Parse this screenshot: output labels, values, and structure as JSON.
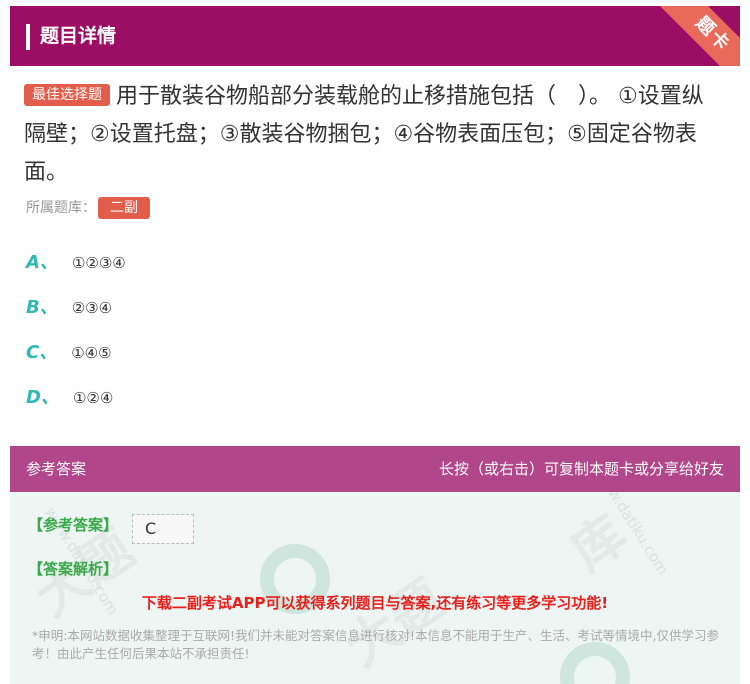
{
  "header": {
    "title": "题目详情",
    "corner_label": "题卡"
  },
  "question": {
    "tag": "最佳选择题",
    "text": "用于散装谷物船部分装载舱的止移措施包括（　）。 ①设置纵隔壁；②设置托盘；③散装谷物捆包；④谷物表面压包；⑤固定谷物表 面。",
    "library_label": "所属题库：",
    "library_value": "二副"
  },
  "options": [
    {
      "letter": "A、",
      "text": "①②③④"
    },
    {
      "letter": "B、",
      "text": "②③④"
    },
    {
      "letter": "C、",
      "text": "①④⑤"
    },
    {
      "letter": "D、",
      "text": "①②④"
    }
  ],
  "answer_bar": {
    "left": "参考答案",
    "right": "长按（或右击）可复制本题卡或分享给好友"
  },
  "answer": {
    "ref_label": "【参考答案】",
    "ref_value": "C",
    "analysis_label": "【答案解析】",
    "promo": "下载二副考试APP可以获得系列题目与答案,还有练习等更多学习功能!",
    "disclaimer": "*申明:本网站数据收集整理于互联网!我们并未能对答案信息进行核对!本信息不能用于生产、生活、考试等情境中,仅供学习参考！由此产生任何后果本站不承担责任!"
  },
  "colors": {
    "header": "#9c0d64",
    "answer_bar": "#b2468a",
    "accent": "#2fb8b4",
    "tag": "#e25d4b",
    "promo": "#e8201c"
  }
}
